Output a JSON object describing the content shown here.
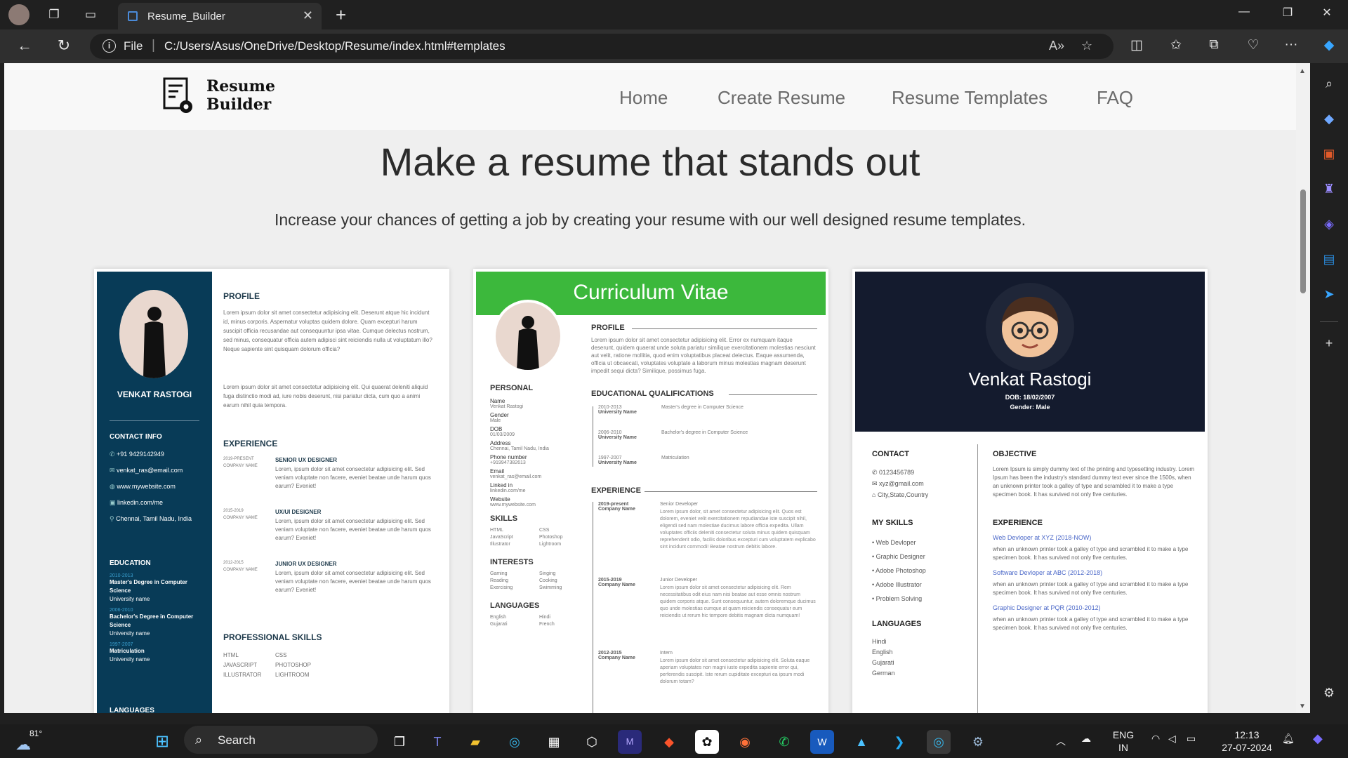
{
  "browser": {
    "tab_title": "Resume_Builder",
    "address_scheme": "File",
    "address_url": "C:/Users/Asus/OneDrive/Desktop/Resume/index.html#templates"
  },
  "site": {
    "logo_line1": "Resume",
    "logo_line2": "Builder",
    "nav": [
      "Home",
      "Create Resume",
      "Resume Templates",
      "FAQ"
    ],
    "hero_title": "Make a resume that stands out",
    "hero_subtitle": "Increase your chances of getting a job by creating your resume with our well designed resume templates."
  },
  "template1": {
    "name": "VENKAT RASTOGI",
    "contact_heading": "CONTACT INFO",
    "contacts": [
      "+91 9429142949",
      "venkat_ras@email.com",
      "www.mywebsite.com",
      "linkedin.com/me",
      "Chennai, Tamil Nadu, India"
    ],
    "education_heading": "EDUCATION",
    "education": [
      {
        "years": "2010-2013",
        "degree": "Master's Degree in Computer Science",
        "school": "University name"
      },
      {
        "years": "2006-2010",
        "degree": "Bachelor's Degree in Computer Science",
        "school": "University name"
      },
      {
        "years": "1997-2007",
        "degree": "Matriculation",
        "school": "University name"
      }
    ],
    "languages_heading": "LANGUAGES",
    "profile_heading": "PROFILE",
    "profile_p1": "Lorem ipsum dolor sit amet consectetur adipisicing elit. Deserunt atque hic incidunt id, minus corporis. Aspernatur voluptas quidem dolore. Quam excepturi harum suscipit officia recusandae aut consequuntur ipsa vitae. Cumque delectus nostrum, sed minus, consequatur officia autem adipisci sint reiciendis nulla ut voluptatum illo? Neque sapiente sint quisquam dolorum officia?",
    "profile_p2": "Lorem ipsum dolor sit amet consectetur adipisicing elit. Qui quaerat deleniti aliquid fuga distinctio modi ad, iure nobis deserunt, nisi pariatur dicta, cum quo a animi earum nihil quia tempora.",
    "experience_heading": "EXPERIENCE",
    "experience": [
      {
        "years": "2019-PRESENT",
        "company": "COMPANY NAME",
        "role": "SENIOR UX DESIGNER",
        "text": "Lorem, ipsum dolor sit amet consectetur adipisicing elit. Sed veniam voluptate non facere, eveniet beatae unde harum quos earum? Eveniet!"
      },
      {
        "years": "2015-2019",
        "company": "COMPANY NAME",
        "role": "UX/UI DESIGNER",
        "text": "Lorem, ipsum dolor sit amet consectetur adipisicing elit. Sed veniam voluptate non facere, eveniet beatae unde harum quos earum? Eveniet!"
      },
      {
        "years": "2012-2015",
        "company": "COMPANY NAME",
        "role": "JUNIOR UX DESIGNER",
        "text": "Lorem, ipsum dolor sit amet consectetur adipisicing elit. Sed veniam voluptate non facere, eveniet beatae unde harum quos earum? Eveniet!"
      }
    ],
    "skills_heading": "PROFESSIONAL SKILLS",
    "skills_col1": [
      "HTML",
      "JAVASCRIPT",
      "ILLUSTRATOR"
    ],
    "skills_col2": [
      "CSS",
      "PHOTOSHOP",
      "LIGHTROOM"
    ]
  },
  "template2": {
    "header": "Curriculum Vitae",
    "personal_heading": "PERSONAL",
    "personal": [
      {
        "label": "Name",
        "value": "Venkat Rastogi"
      },
      {
        "label": "Gender",
        "value": "Male"
      },
      {
        "label": "DOB",
        "value": "01/03/2009"
      },
      {
        "label": "Address",
        "value": "Chennai, Tamil Nadu, India"
      },
      {
        "label": "Phone number",
        "value": "+919947382613"
      },
      {
        "label": "Email",
        "value": "venkat_ras@email.com"
      },
      {
        "label": "Linked in",
        "value": "linkedin.com/me"
      },
      {
        "label": "Website",
        "value": "www.mywebsite.com"
      }
    ],
    "skills_heading": "SKILLS",
    "skills_col1": [
      "HTML",
      "JavaScript",
      "Illustrator"
    ],
    "skills_col2": [
      "CSS",
      "Photoshop",
      "Lightroom"
    ],
    "interests_heading": "INTERESTS",
    "interests_col1": [
      "Gaming",
      "Reading",
      "Exercising"
    ],
    "interests_col2": [
      "Singing",
      "Cooking",
      "Swimming"
    ],
    "languages_heading": "LANGUAGES",
    "languages_col1": [
      "English",
      "Gujarati"
    ],
    "languages_col2": [
      "Hindi",
      "French"
    ],
    "profile_heading": "PROFILE",
    "profile_text": "Lorem ipsum dolor sit amet consectetur adipisicing elit. Error ex numquam itaque deserunt, quidem quaerat unde soluta pariatur similique exercitationem molestias nesciunt aut velit, ratione mollitia, quod enim voluptatibus placeat delectus. Eaque assumenda, officia ut obcaecati, voluptates voluptate a laborum minus molestias magnam deserunt impedit sequi dicta? Similique, possimus fuga.",
    "edu_heading": "EDUCATIONAL QUALIFICATIONS",
    "education": [
      {
        "years": "2010-2013",
        "school": "University Name",
        "degree": "Master's degree in Computer Science"
      },
      {
        "years": "2006-2010",
        "school": "University Name",
        "degree": "Bachelor's degree in Computer Science"
      },
      {
        "years": "1997-2007",
        "school": "University Name",
        "degree": "Matriculation"
      }
    ],
    "experience_heading": "EXPERIENCE",
    "experience": [
      {
        "years": "2019-present",
        "company": "Company Name",
        "role": "Senior Developer",
        "text": "Lorem ipsum dolor, sit amet consectetur adipisicing elit. Quos est dolorem, eveniet velit exercitationem repudiandae iste suscipit nihil, eligendi sed nam molestiae ducimus labore officia expedita. Ullam voluptates officiis deleniti consectetur soluta minus quidem quisquam reprehenderit odio, facilis doloribus excepturi cum voluptatem explicabo sint incidunt commodi! Beatae nostrum debitis labore."
      },
      {
        "years": "2015-2019",
        "company": "Company Name",
        "role": "Junior Developer",
        "text": "Lorem ipsum dolor sit amet consectetur adipisicing elit. Rem necessitatibus odit eius nam nisi beatae aut esse omnis nostrum quidem corporis atque. Sunt consequuntur, autem doloremque ducimus quo unde molestias cumque at quam reiciendis consequatur eum reiciendis ut rerum hic tempore debitis magnam dicta numquam!"
      },
      {
        "years": "2012-2015",
        "company": "Company Name",
        "role": "Intern",
        "text": "Lorem ipsum dolor sit amet consectetur adipisicing elit. Soluta eaque aperiam voluptates non magni iusto expedita sapiente error qui, perferendis suscipit. Iste rerum cupiditate excepturi ea ipsum modi dolorum totam?"
      }
    ]
  },
  "template3": {
    "name": "Venkat Rastogi",
    "dob": "DOB: 18/02/2007",
    "gender": "Gender: Male",
    "contact_heading": "CONTACT",
    "contacts": [
      "0123456789",
      "xyz@gmail.com",
      "City,State,Country"
    ],
    "skills_heading": "MY SKILLS",
    "skills": [
      "Web Devloper",
      "Graphic Designer",
      "Adobe Photoshop",
      "Adobe Illustrator",
      "Problem Solving"
    ],
    "languages_heading": "LANGUAGES",
    "languages": [
      "Hindi",
      "English",
      "Gujarati",
      "German"
    ],
    "objective_heading": "OBJECTIVE",
    "objective_text": "Lorem Ipsum is simply dummy text of the printing and typesetting industry. Lorem Ipsum has been the industry's standard dummy text ever since the 1500s, when an unknown printer took a galley of type and scrambled it to make a type specimen book. It has survived not only five centuries.",
    "experience_heading": "EXPERIENCE",
    "experience": [
      {
        "title": "Web Devloper at XYZ (2018-NOW)",
        "text": "when an unknown printer took a galley of type and scrambled it to make a type specimen book. It has survived not only five centuries."
      },
      {
        "title": "Software Devloper at ABC (2012-2018)",
        "text": "when an unknown printer took a galley of type and scrambled it to make a type specimen book. It has survived not only five centuries."
      },
      {
        "title": "Graphic Designer at PQR (2010-2012)",
        "text": "when an unknown printer took a galley of type and scrambled it to make a type specimen book. It has survived not only five centuries."
      }
    ]
  },
  "taskbar": {
    "weather": "81°",
    "search_label": "Search",
    "lang_line1": "ENG",
    "lang_line2": "IN",
    "time": "12:13",
    "date": "27-07-2024"
  },
  "colors": {
    "t1_sidebar": "#083b57",
    "t2_header": "#3cb83c",
    "t3_header": "#141b2e"
  }
}
